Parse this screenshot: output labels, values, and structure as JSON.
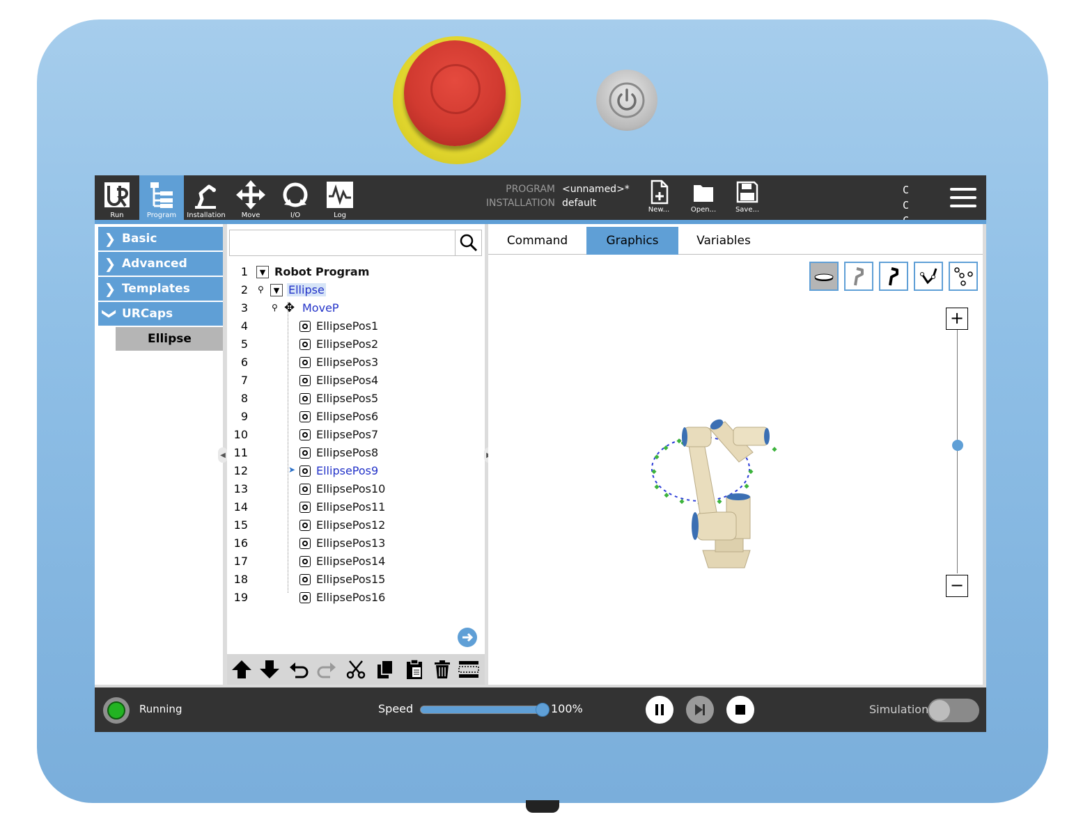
{
  "colors": {
    "accent": "#5f9fd6",
    "topbar": "#333333",
    "estop_red": "#d13a30",
    "estop_yellow": "#e1d62e",
    "status_green": "#22b322"
  },
  "nav": {
    "items": [
      {
        "label": "Run",
        "icon": "ur-logo-icon"
      },
      {
        "label": "Program",
        "icon": "program-tree-icon",
        "active": true
      },
      {
        "label": "Installation",
        "icon": "robot-arm-icon"
      },
      {
        "label": "Move",
        "icon": "move-arrows-icon"
      },
      {
        "label": "I/O",
        "icon": "io-icon"
      },
      {
        "label": "Log",
        "icon": "log-chart-icon"
      }
    ]
  },
  "program_info": {
    "program_key": "PROGRAM",
    "program_value": "<unnamed>*",
    "installation_key": "INSTALLATION",
    "installation_value": "default"
  },
  "file_buttons": {
    "new": "New...",
    "open": "Open...",
    "save": "Save..."
  },
  "cc": {
    "row1": "C C",
    "row2": "C C"
  },
  "left_menu": {
    "categories": [
      {
        "label": "Basic",
        "expanded": false
      },
      {
        "label": "Advanced",
        "expanded": false
      },
      {
        "label": "Templates",
        "expanded": false
      },
      {
        "label": "URCaps",
        "expanded": true
      }
    ],
    "urcaps_items": [
      "Ellipse"
    ]
  },
  "tree": {
    "search_placeholder": "",
    "rows": [
      {
        "num": "1",
        "text": "Robot Program"
      },
      {
        "num": "2",
        "text": "Ellipse"
      },
      {
        "num": "3",
        "text": "MoveP"
      },
      {
        "num": "4",
        "text": "EllipsePos1"
      },
      {
        "num": "5",
        "text": "EllipsePos2"
      },
      {
        "num": "6",
        "text": "EllipsePos3"
      },
      {
        "num": "7",
        "text": "EllipsePos4"
      },
      {
        "num": "8",
        "text": "EllipsePos5"
      },
      {
        "num": "9",
        "text": "EllipsePos6"
      },
      {
        "num": "10",
        "text": "EllipsePos7"
      },
      {
        "num": "11",
        "text": "EllipsePos8"
      },
      {
        "num": "12",
        "text": "EllipsePos9",
        "current": true
      },
      {
        "num": "13",
        "text": "EllipsePos10"
      },
      {
        "num": "14",
        "text": "EllipsePos11"
      },
      {
        "num": "15",
        "text": "EllipsePos12"
      },
      {
        "num": "16",
        "text": "EllipsePos13"
      },
      {
        "num": "17",
        "text": "EllipsePos14"
      },
      {
        "num": "18",
        "text": "EllipsePos15"
      },
      {
        "num": "19",
        "text": "EllipsePos16"
      }
    ]
  },
  "tree_toolbar": [
    "move-up-icon",
    "move-down-icon",
    "undo-icon",
    "redo-icon",
    "cut-icon",
    "copy-icon",
    "paste-icon",
    "delete-icon",
    "suppress-icon"
  ],
  "tabs": [
    {
      "label": "Command"
    },
    {
      "label": "Graphics",
      "active": true
    },
    {
      "label": "Variables"
    }
  ],
  "view_buttons": [
    "base-view-icon",
    "side-view-icon",
    "front-view-icon",
    "path-view-icon",
    "waypoints-view-icon"
  ],
  "zoom": {
    "in": "+",
    "out": "−",
    "level": 0.5
  },
  "status": {
    "state": "Running",
    "speed_label": "Speed",
    "speed_value": "100%",
    "speed_fraction": 1.0,
    "simulation_label": "Simulation",
    "simulation_on": false
  }
}
